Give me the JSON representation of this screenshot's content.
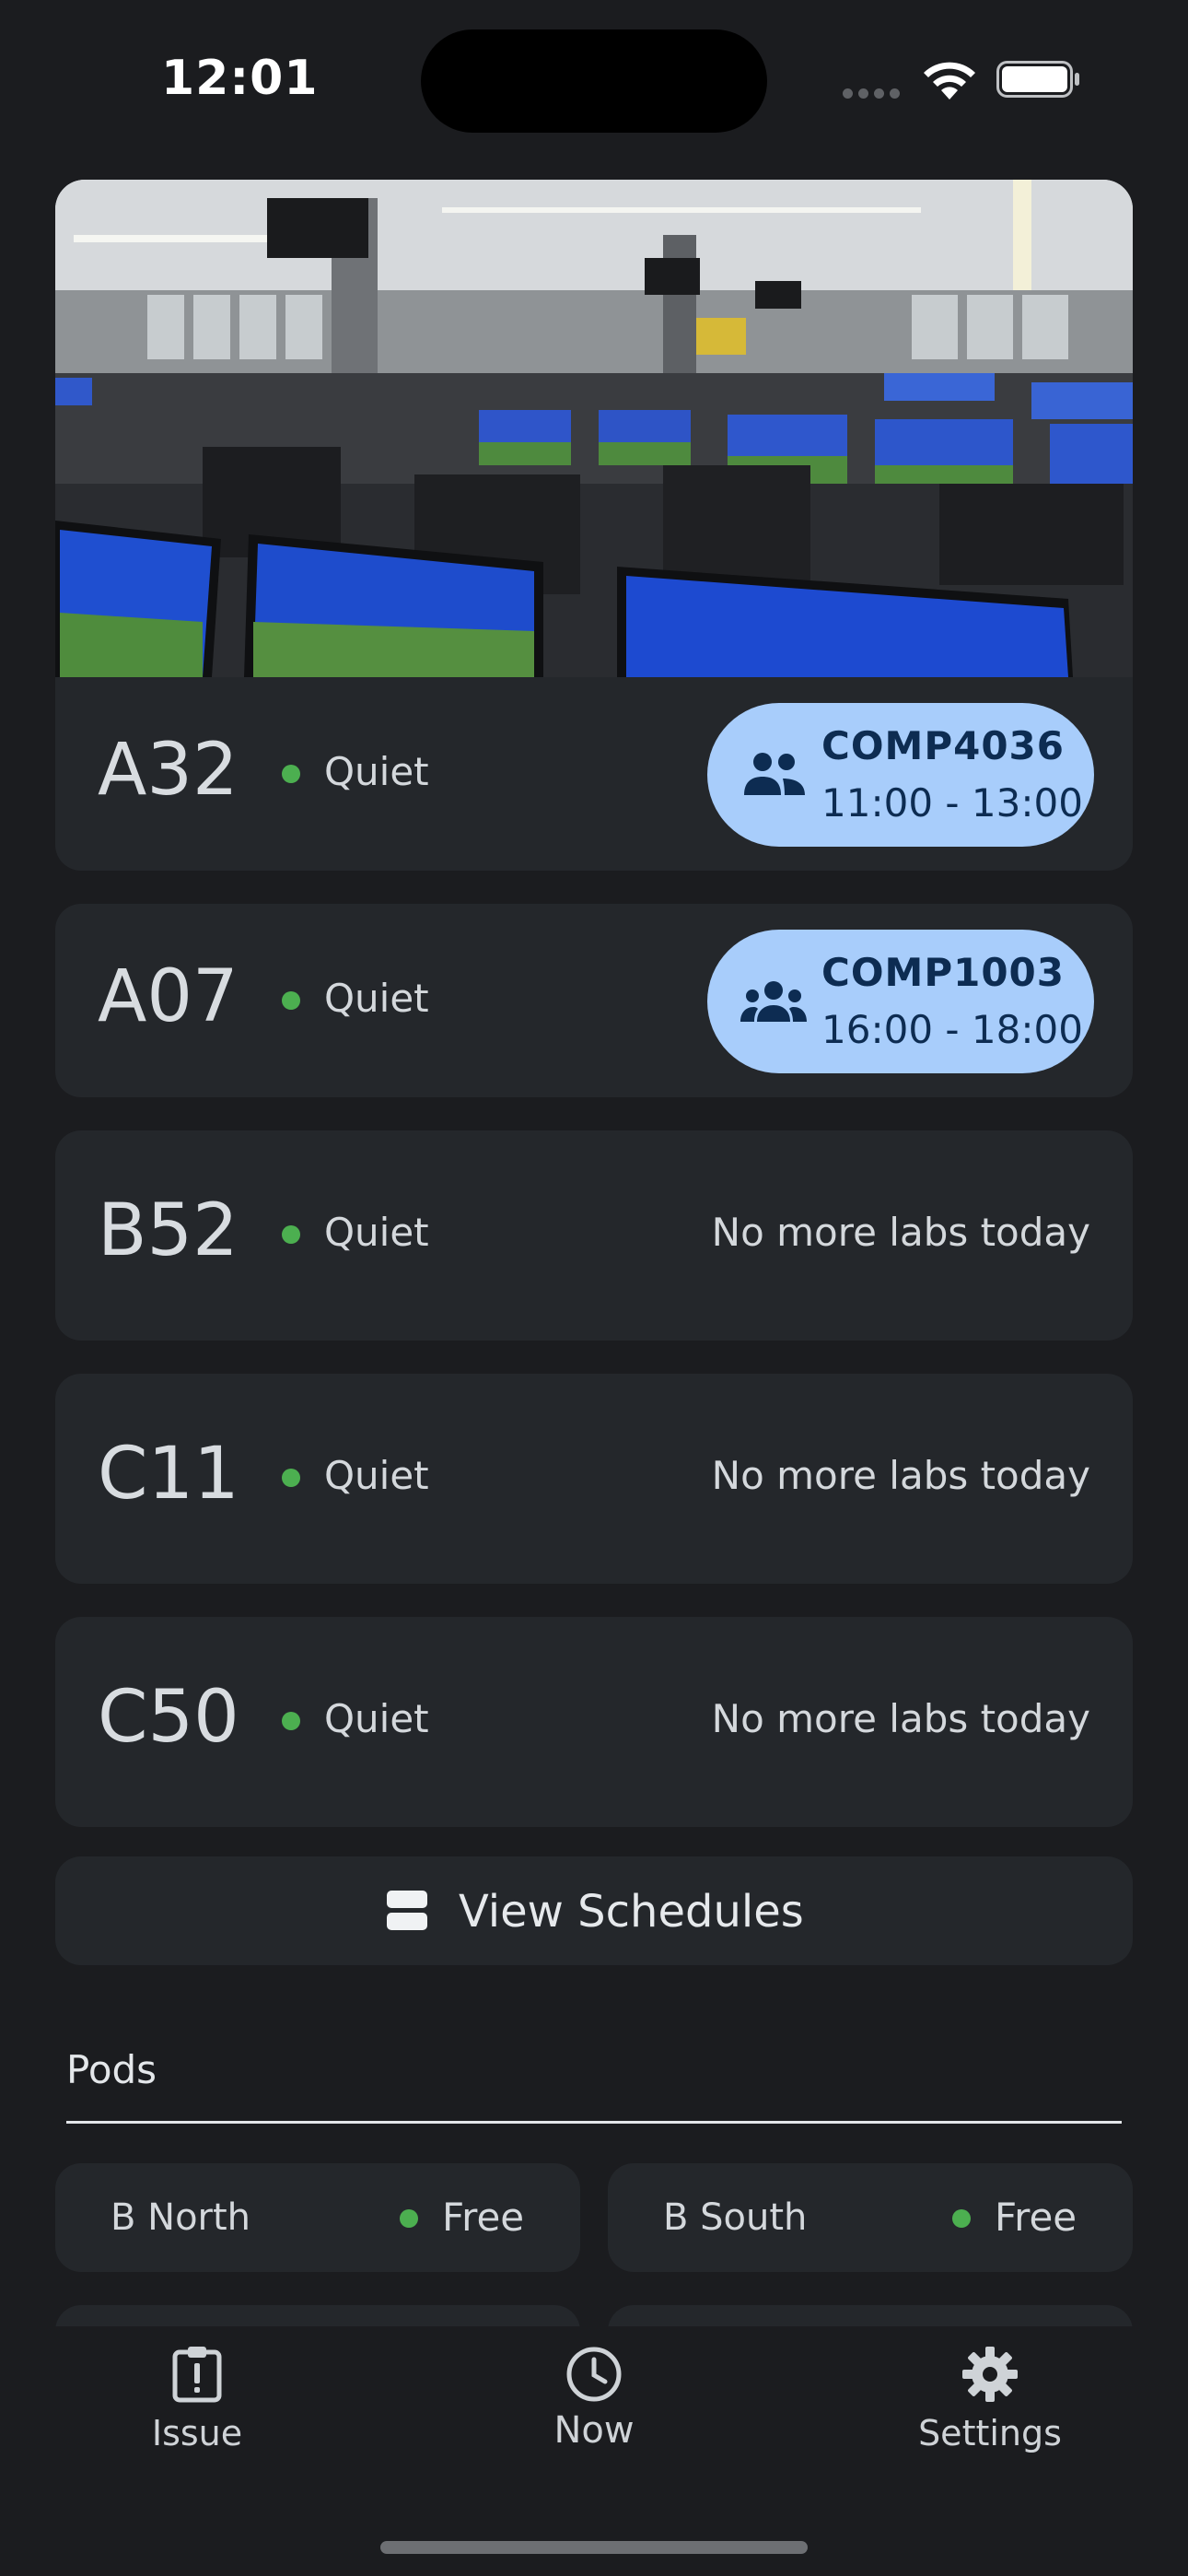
{
  "status_bar": {
    "time": "12:01"
  },
  "labs": [
    {
      "room": "A32",
      "status": "Quiet",
      "session": {
        "code": "COMP4036",
        "hours": "11:00 - 13:00",
        "icon": "group-icon"
      }
    },
    {
      "room": "A07",
      "status": "Quiet",
      "session": {
        "code": "COMP1003",
        "hours": "16:00 - 18:00",
        "icon": "groups-icon"
      }
    },
    {
      "room": "B52",
      "status": "Quiet",
      "note": "No more labs today"
    },
    {
      "room": "C11",
      "status": "Quiet",
      "note": "No more labs today"
    },
    {
      "room": "C50",
      "status": "Quiet",
      "note": "No more labs today"
    }
  ],
  "view_schedules": {
    "label": "View Schedules",
    "icon": "view-agenda-icon"
  },
  "pods": {
    "title": "Pods",
    "items": [
      {
        "name": "B North",
        "status": "Free"
      },
      {
        "name": "B South",
        "status": "Free"
      }
    ]
  },
  "nav": {
    "items": [
      {
        "label": "Issue",
        "icon": "report-clipboard-icon"
      },
      {
        "label": "Now",
        "icon": "clock-icon"
      },
      {
        "label": "Settings",
        "icon": "gear-icon"
      }
    ]
  },
  "colors": {
    "background": "#1b1c1f",
    "card": "#24272b",
    "pill": "#a8cdfb",
    "pill_text": "#0d2c52",
    "status_dot": "#4caf50"
  }
}
